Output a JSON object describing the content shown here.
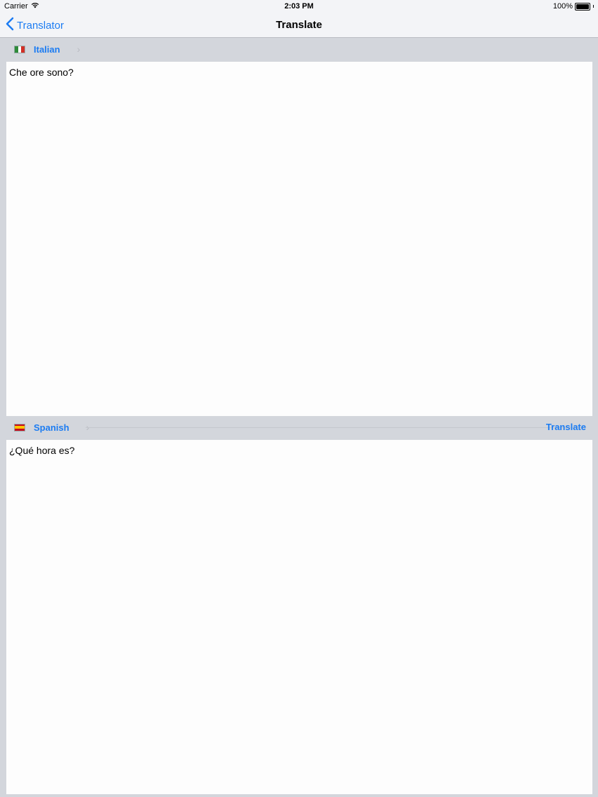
{
  "status": {
    "carrier": "Carrier",
    "time": "2:03 PM",
    "battery": "100%",
    "battery_level": 1.0
  },
  "nav": {
    "back_label": "Translator",
    "title": "Translate"
  },
  "source": {
    "language": "Italian",
    "flag_icon": "italy-flag-icon",
    "text": "Che ore sono?"
  },
  "target": {
    "language": "Spanish",
    "flag_icon": "spain-flag-icon",
    "text": "¿Qué hora es?",
    "translate_label": "Translate"
  },
  "colors": {
    "accent": "#1c7cf2",
    "bar_background": "#d3d6dc",
    "nav_background": "#f3f4f7"
  }
}
